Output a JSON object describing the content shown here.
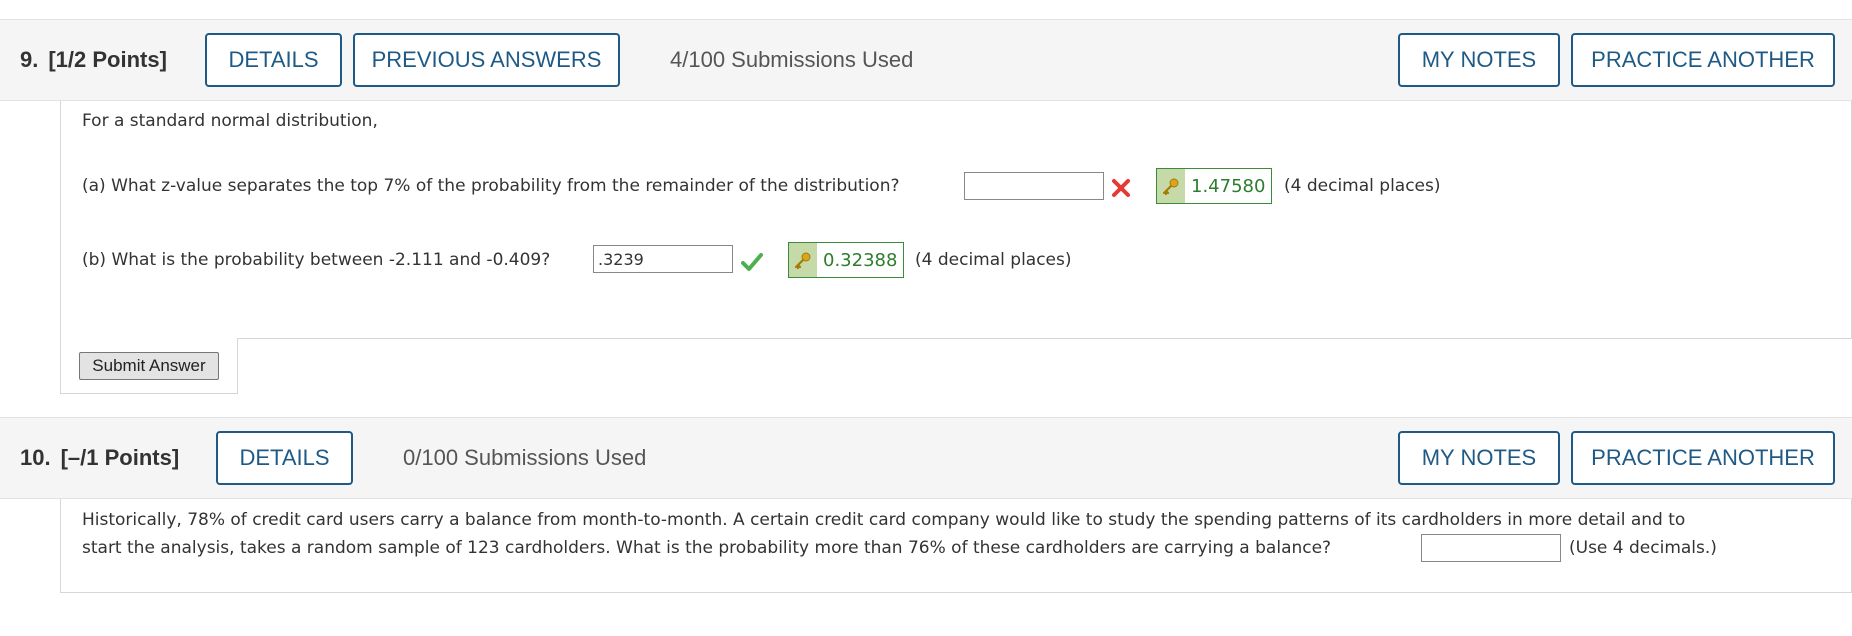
{
  "questions": [
    {
      "number": "9.",
      "points": "[1/2 Points]",
      "buttons": {
        "details": "DETAILS",
        "previous": "PREVIOUS ANSWERS",
        "notes": "MY NOTES",
        "practice": "PRACTICE ANOTHER"
      },
      "submissions": "4/100 Submissions Used",
      "intro": "For a standard normal distribution,",
      "parts": [
        {
          "prompt": "(a) What z-value separates the top 7% of the probability from the remainder of the distribution?",
          "value": "",
          "status": "incorrect",
          "key_answer": "1.47580",
          "hint": "(4 decimal places)"
        },
        {
          "prompt": "(b) What is the probability between -2.111 and -0.409?",
          "value": ".3239",
          "status": "correct",
          "key_answer": "0.32388",
          "hint": "(4 decimal places)"
        }
      ],
      "submit_label": "Submit Answer"
    },
    {
      "number": "10.",
      "points": "[–/1 Points]",
      "buttons": {
        "details": "DETAILS",
        "notes": "MY NOTES",
        "practice": "PRACTICE ANOTHER"
      },
      "submissions": "0/100 Submissions Used",
      "text_line1": "Historically, 78% of credit card users carry a balance from month-to-month. A certain credit card company would like to study the spending patterns of its cardholders in more detail and to",
      "text_line2": "start the analysis, takes a random sample of 123 cardholders. What is the probability more than 76% of these cardholders are carrying a balance?",
      "value": "",
      "hint": "(Use 4 decimals.)"
    }
  ],
  "colors": {
    "link_blue": "#1f5a86",
    "correct_green": "#2e7d2e",
    "incorrect_red": "#e53935",
    "key_bg": "#c6d9a8"
  }
}
